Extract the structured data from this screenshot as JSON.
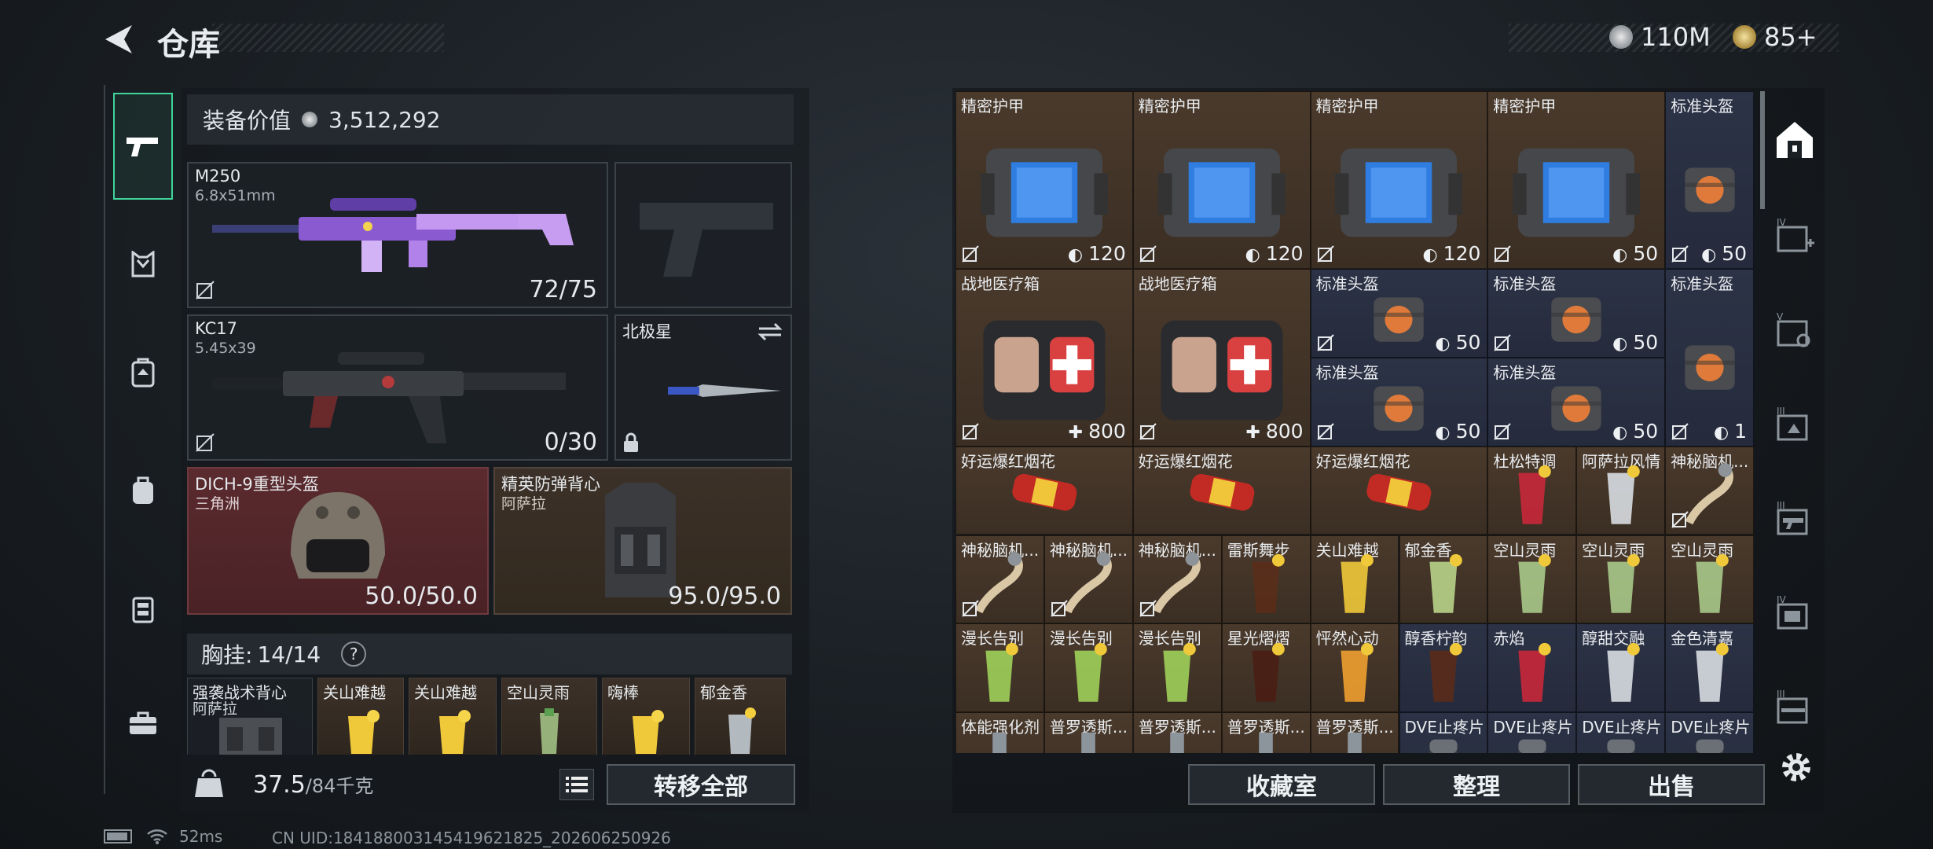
{
  "header": {
    "title": "仓库",
    "currency": [
      {
        "icon": "silver-coin-icon",
        "value": "110M"
      },
      {
        "icon": "gold-coin-icon",
        "value": "85+"
      }
    ]
  },
  "left": {
    "equip_value_label": "装备价值",
    "equip_value": "3,512,292",
    "primary": {
      "name": "M250",
      "caliber": "6.8x51mm",
      "ammo": "72/75"
    },
    "secondary": {
      "name": "KC17",
      "caliber": "5.45x39",
      "ammo": "0/30"
    },
    "melee": {
      "name": "北极星"
    },
    "helmet": {
      "name": "DICH-9重型头盔",
      "sub": "三角洲",
      "durability": "50.0/50.0"
    },
    "armor": {
      "name": "精英防弹背心",
      "sub": "阿萨拉",
      "durability": "95.0/95.0"
    },
    "chest_label": "胸挂:",
    "chest_count": "14/14",
    "chest_help": "?",
    "chest_items": [
      {
        "name": "强袭战术背心",
        "sub": "阿萨拉"
      },
      {
        "name": "关山难越"
      },
      {
        "name": "关山难越"
      },
      {
        "name": "空山灵雨"
      },
      {
        "name": "嗨棒"
      },
      {
        "name": "郁金香"
      }
    ],
    "weight": "37.5",
    "weight_max": "/84千克",
    "transfer_all": "转移全部"
  },
  "status": {
    "ping": "52ms",
    "uid": "CN UID:184188003145419621825_202606250926"
  },
  "stash": {
    "items": [
      {
        "name": "精密护甲",
        "dur": "120",
        "bg": "br"
      },
      {
        "name": "精密护甲",
        "dur": "120",
        "bg": "br"
      },
      {
        "name": "精密护甲",
        "dur": "120",
        "bg": "br"
      },
      {
        "name": "精密护甲",
        "dur": "50",
        "bg": "br"
      },
      {
        "name": "标准头盔",
        "dur": "50",
        "bg": "bl"
      },
      {
        "name": "战地医疗箱",
        "dur": "800",
        "bg": "br"
      },
      {
        "name": "战地医疗箱",
        "dur": "800",
        "bg": "br"
      },
      {
        "name": "标准头盔",
        "dur": "50",
        "bg": "bl"
      },
      {
        "name": "标准头盔",
        "dur": "50",
        "bg": "bl"
      },
      {
        "name": "标准头盔",
        "dur": "1",
        "bg": "bl"
      },
      {
        "name": "标准头盔",
        "dur": "50",
        "bg": "bl"
      },
      {
        "name": "标准头盔",
        "dur": "50",
        "bg": "bl"
      },
      {
        "name": "好运爆红烟花",
        "dur": "",
        "bg": "br"
      },
      {
        "name": "好运爆红烟花",
        "dur": "",
        "bg": "br"
      },
      {
        "name": "好运爆红烟花",
        "dur": "",
        "bg": "br"
      },
      {
        "name": "杜松特调",
        "dur": "",
        "bg": "br"
      },
      {
        "name": "阿萨拉风情",
        "dur": "",
        "bg": "br"
      },
      {
        "name": "神秘脑机...",
        "dur": "",
        "bg": "br"
      },
      {
        "name": "神秘脑机...",
        "dur": "",
        "bg": "br"
      },
      {
        "name": "神秘脑机...",
        "dur": "",
        "bg": "br"
      },
      {
        "name": "神秘脑机...",
        "dur": "",
        "bg": "br"
      },
      {
        "name": "雷斯舞步",
        "dur": "",
        "bg": "br"
      },
      {
        "name": "关山难越",
        "dur": "",
        "bg": "br"
      },
      {
        "name": "郁金香",
        "dur": "",
        "bg": "br"
      },
      {
        "name": "空山灵雨",
        "dur": "",
        "bg": "br"
      },
      {
        "name": "空山灵雨",
        "dur": "",
        "bg": "br"
      },
      {
        "name": "空山灵雨",
        "dur": "",
        "bg": "br"
      },
      {
        "name": "漫长告别",
        "dur": "",
        "bg": "br"
      },
      {
        "name": "漫长告别",
        "dur": "",
        "bg": "br"
      },
      {
        "name": "漫长告别",
        "dur": "",
        "bg": "br"
      },
      {
        "name": "星光熠熠",
        "dur": "",
        "bg": "br"
      },
      {
        "name": "怦然心动",
        "dur": "",
        "bg": "br"
      },
      {
        "name": "醇香柠韵",
        "dur": "",
        "bg": "bl"
      },
      {
        "name": "赤焰",
        "dur": "",
        "bg": "bl"
      },
      {
        "name": "醇甜交融",
        "dur": "",
        "bg": "bl"
      },
      {
        "name": "金色清嘉",
        "dur": "",
        "bg": "bl"
      },
      {
        "name": "体能强化剂",
        "dur": "",
        "bg": "br"
      },
      {
        "name": "普罗透斯...",
        "dur": "",
        "bg": "br"
      },
      {
        "name": "普罗透斯...",
        "dur": "",
        "bg": "br"
      },
      {
        "name": "普罗透斯...",
        "dur": "",
        "bg": "br"
      },
      {
        "name": "普罗透斯...",
        "dur": "",
        "bg": "br"
      },
      {
        "name": "DVE止疼片",
        "dur": "",
        "bg": "bl"
      },
      {
        "name": "DVE止疼片",
        "dur": "",
        "bg": "bl"
      },
      {
        "name": "DVE止疼片",
        "dur": "",
        "bg": "bl"
      },
      {
        "name": "DVE止疼片",
        "dur": "",
        "bg": "bl"
      }
    ],
    "buttons": {
      "collection": "收藏室",
      "sort": "整理",
      "sell": "出售"
    }
  }
}
